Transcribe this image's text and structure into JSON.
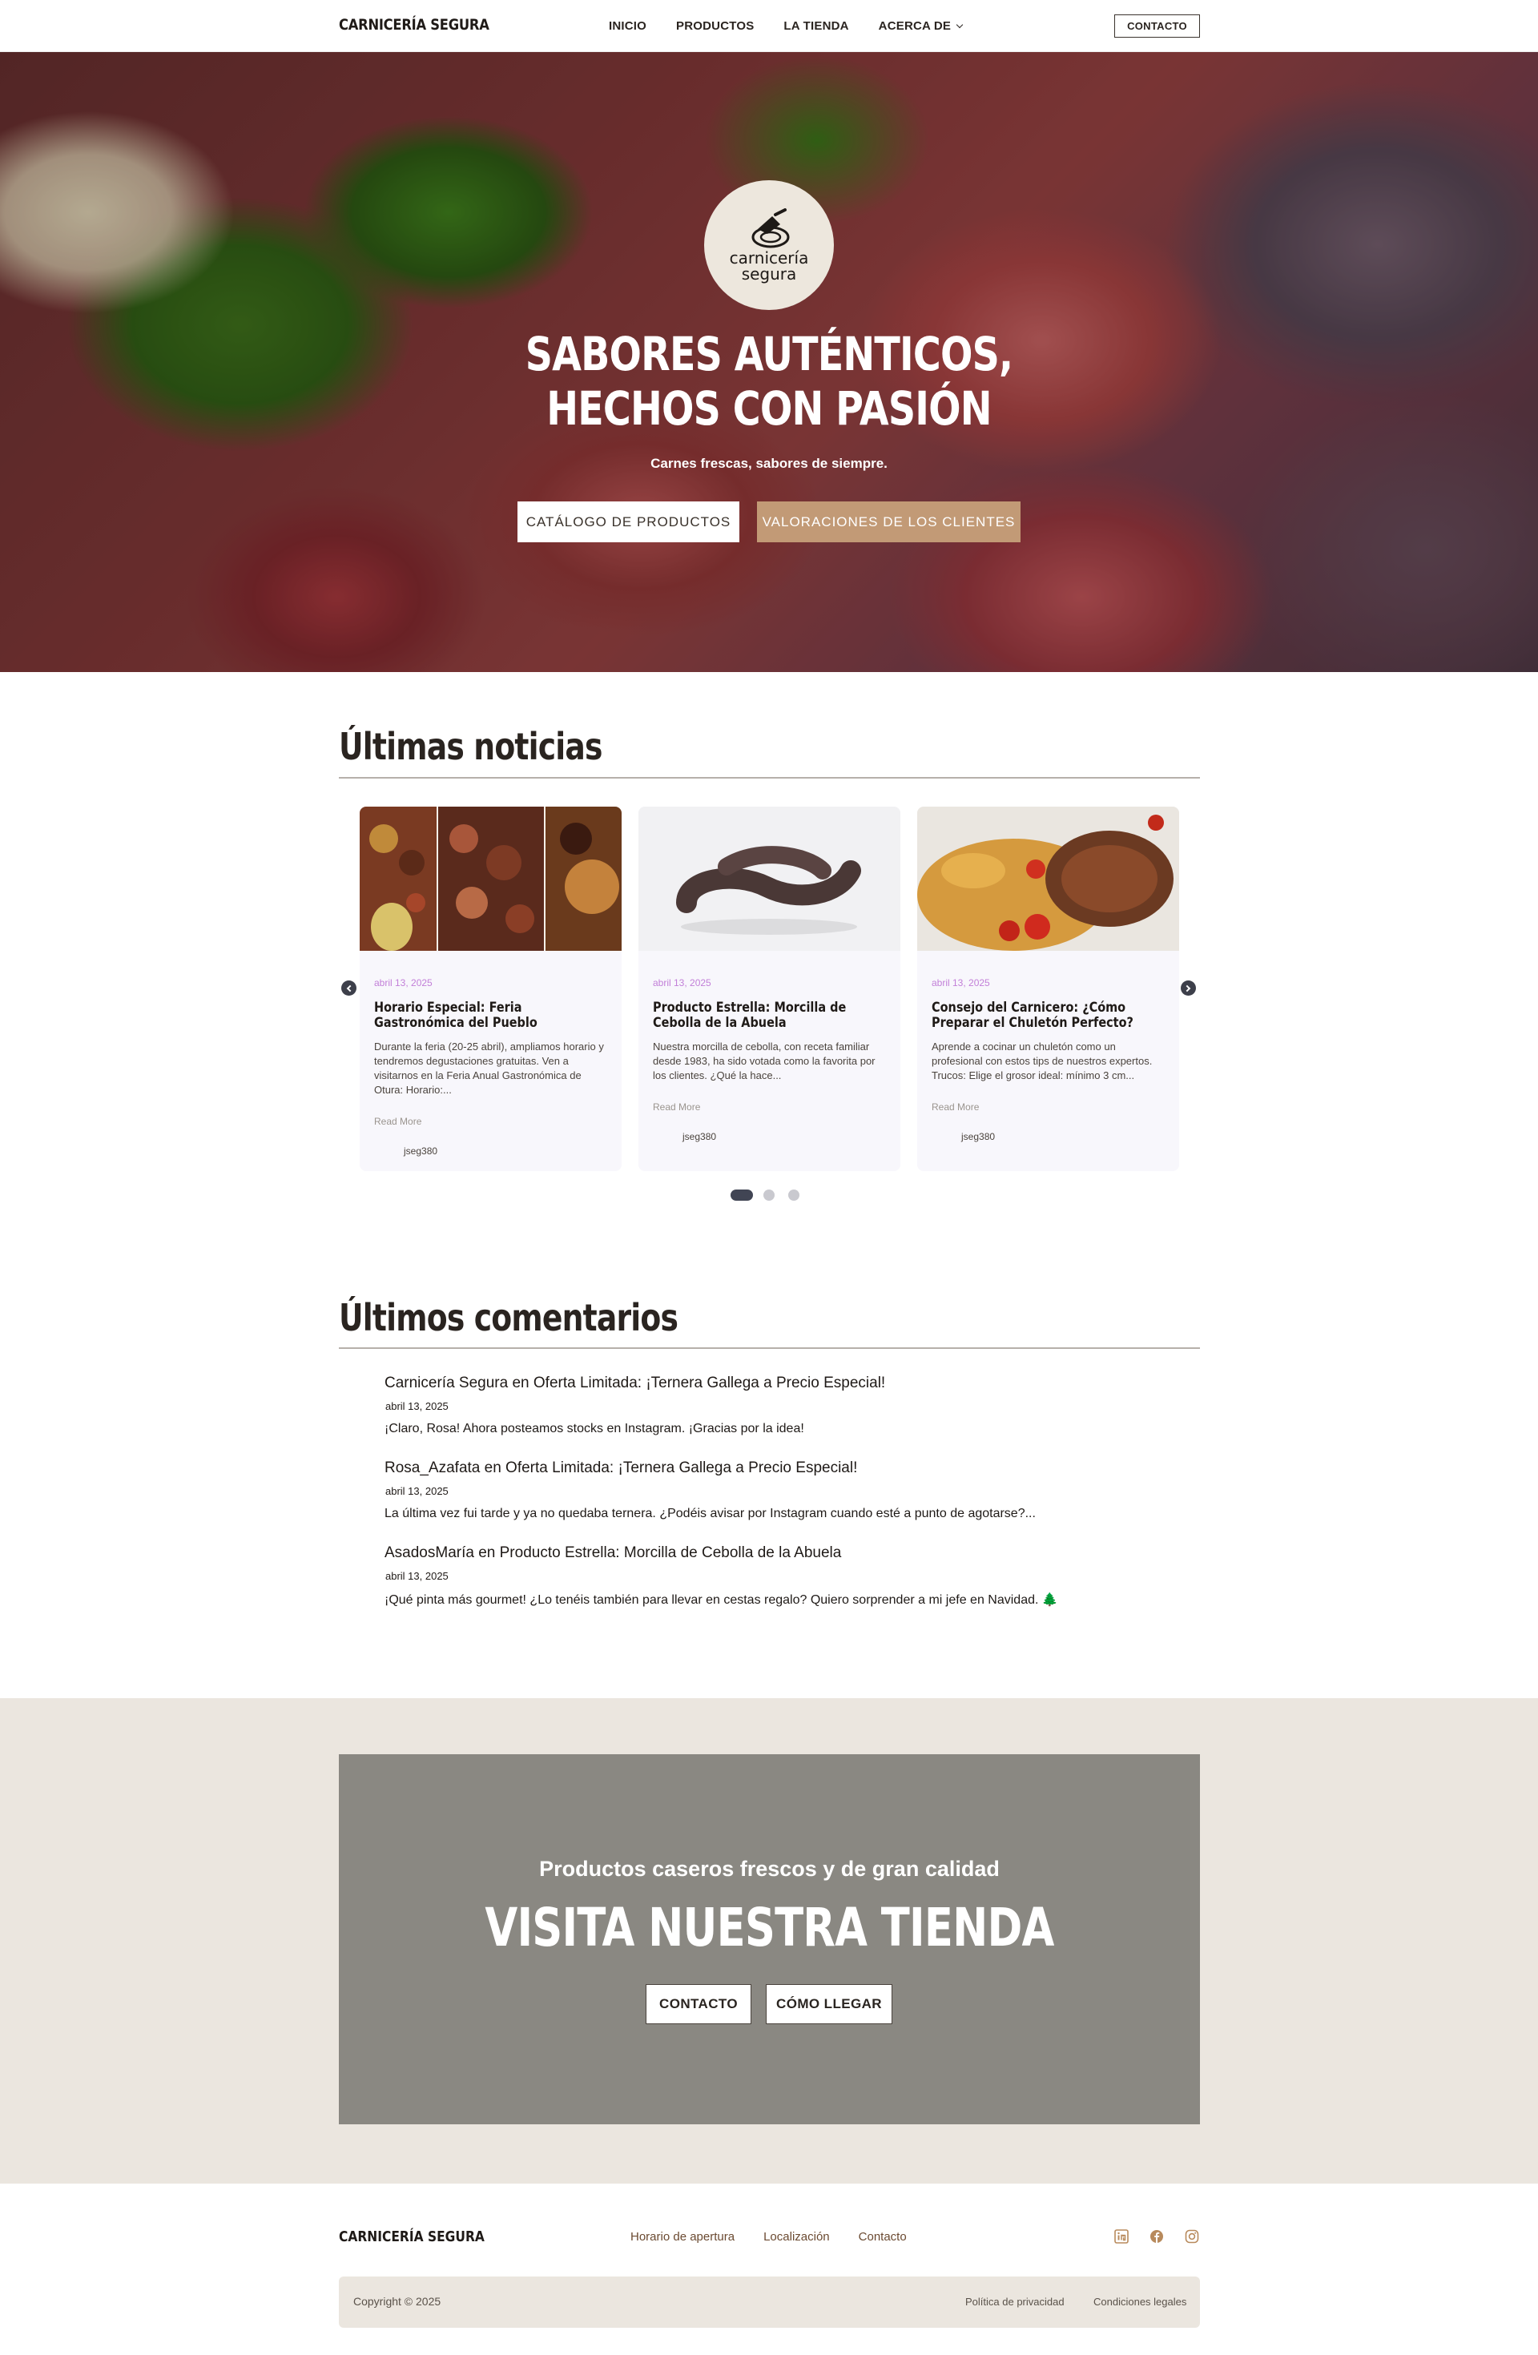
{
  "header": {
    "logo": "CARNICERÍA SEGURA",
    "nav": [
      "INICIO",
      "PRODUCTOS",
      "LA TIENDA",
      "ACERCA DE"
    ],
    "contact": "CONTACTO"
  },
  "hero": {
    "emblem_line1": "carnicería",
    "emblem_line2": "segura",
    "title_line1": "SABORES AUTÉNTICOS,",
    "title_line2": "HECHOS CON PASIÓN",
    "subtitle": "Carnes frescas, sabores de siempre.",
    "btn_catalog": "CATÁLOGO DE PRODUCTOS",
    "btn_reviews": "VALORACIONES DE LOS CLIENTES"
  },
  "news": {
    "title": "Últimas noticias",
    "cards": [
      {
        "date": "abril 13, 2025",
        "title": "Horario Especial: Feria Gastronómica del Pueblo",
        "excerpt": "Durante la feria (20-25 abril), ampliamos horario y tendremos degustaciones gratuitas. Ven a visitarnos en la Feria Anual Gastronómica de Otura: Horario:...",
        "more": "Read More",
        "author": "jseg380"
      },
      {
        "date": "abril 13, 2025",
        "title": "Producto Estrella: Morcilla de Cebolla de la Abuela",
        "excerpt": "Nuestra morcilla de cebolla, con receta familiar desde 1983, ha sido votada como la favorita por los clientes. ¿Qué la hace...",
        "more": "Read More",
        "author": "jseg380"
      },
      {
        "date": "abril 13, 2025",
        "title": "Consejo del Carnicero: ¿Cómo Preparar el Chuletón Perfecto?",
        "excerpt": "Aprende a cocinar un chuletón como un profesional con estos tips de nuestros expertos. Trucos: Elige el grosor ideal: mínimo 3 cm...",
        "more": "Read More",
        "author": "jseg380"
      }
    ]
  },
  "comments": {
    "title": "Últimos comentarios",
    "items": [
      {
        "head": "Carnicería Segura en Oferta Limitada: ¡Ternera Gallega a Precio Especial!",
        "date": "abril 13, 2025",
        "text": "¡Claro, Rosa! Ahora posteamos stocks en Instagram. ¡Gracias por la idea!"
      },
      {
        "head": "Rosa_Azafata en Oferta Limitada: ¡Ternera Gallega a Precio Especial!",
        "date": "abril 13, 2025",
        "text": "La última vez fui tarde y ya no quedaba ternera. ¿Podéis avisar por Instagram cuando esté a punto de agotarse?..."
      },
      {
        "head": "AsadosMaría en Producto Estrella: Morcilla de Cebolla de la Abuela",
        "date": "abril 13, 2025",
        "text": "¡Qué pinta más gourmet! ¿Lo tenéis también para llevar en cestas regalo? Quiero sorprender a mi jefe en Navidad. 🌲"
      }
    ]
  },
  "cta": {
    "subtitle": "Productos caseros frescos y de gran calidad",
    "title": "VISITA NUESTRA TIENDA",
    "btn_contact": "CONTACTO",
    "btn_directions": "CÓMO LLEGAR"
  },
  "footer": {
    "logo": "CARNICERÍA SEGURA",
    "links": [
      "Horario de apertura",
      "Localización",
      "Contacto"
    ],
    "icons": [
      "linkedin-icon",
      "facebook-icon",
      "instagram-icon"
    ],
    "copyright": "Copyright © 2025",
    "privacy": "Política de privacidad",
    "terms": "Condiciones legales",
    "icon_color": "#b88a5c"
  },
  "colors": {
    "accent_tan": "#c29a76",
    "cta_box": "#8a8882",
    "cta_bg": "#ebe6df",
    "date_purple": "#c27fd8"
  }
}
